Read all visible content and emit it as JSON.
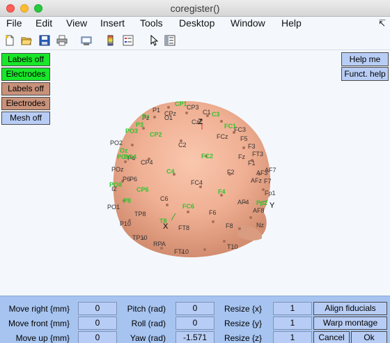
{
  "window": {
    "title": "coregister()"
  },
  "menu": [
    "File",
    "Edit",
    "View",
    "Insert",
    "Tools",
    "Desktop",
    "Window",
    "Help"
  ],
  "toolbar": [
    "new-figure-icon",
    "open-file-icon",
    "save-icon",
    "print-icon",
    "print-preview-icon",
    "colorbar-icon",
    "legend-icon",
    "pointer-icon",
    "property-editor-icon"
  ],
  "left_buttons": [
    {
      "label": "Labels off",
      "color": "#19e62a"
    },
    {
      "label": "Electrodes",
      "color": "#19e62a"
    },
    {
      "label": "Labels off",
      "color": "#c8917a"
    },
    {
      "label": "Electrodes",
      "color": "#c8917a"
    },
    {
      "label": "Mesh off",
      "color": "#b8cdf5"
    }
  ],
  "right_buttons": {
    "help": "Help me",
    "funct_help": "Funct. help"
  },
  "axes": {
    "x_marker": "X",
    "y_marker": "Y",
    "z_marker": "Z"
  },
  "electrodes_green": [
    "CP1",
    "C3",
    "FC1",
    "Pz",
    "P3",
    "CP2",
    "PO3",
    "Oz",
    "POz",
    "PO4",
    "FC2",
    "C4",
    "CP6",
    "PO8",
    "P8",
    "F4",
    "FC6",
    "Fp2",
    "T8"
  ],
  "electrodes_black": [
    "P1",
    "CP3",
    "CPz",
    "C1",
    "CzZ",
    "FC3",
    "FCz",
    "F3",
    "FT3",
    "F5",
    "Fz",
    "F1",
    "AF3",
    "AF7",
    "F7",
    "AFz",
    "F2",
    "FC4",
    "CP4",
    "C2",
    "P4",
    "PO2",
    "P6",
    "POz",
    "I2",
    "P6",
    "Fp1",
    "AF4",
    "AF8",
    "F6",
    "F8",
    "C6",
    "TP8",
    "P10",
    "TP10",
    "RPA",
    "FT8",
    "FT10",
    "Nz",
    "O1",
    "Pz",
    "T10",
    "PO1"
  ],
  "controls": {
    "move_right": {
      "label": "Move right {mm}",
      "value": "0"
    },
    "move_front": {
      "label": "Move front {mm}",
      "value": "0"
    },
    "move_up": {
      "label": "Move up {mm}",
      "value": "0"
    },
    "pitch": {
      "label": "Pitch (rad)",
      "value": "0"
    },
    "roll": {
      "label": "Roll (rad)",
      "value": "0"
    },
    "yaw": {
      "label": "Yaw (rad)",
      "value": "-1.571"
    },
    "resize_x": {
      "label": "Resize {x}",
      "value": "1"
    },
    "resize_y": {
      "label": "Resize {y}",
      "value": "1"
    },
    "resize_z": {
      "label": "Resize {z}",
      "value": "1"
    },
    "align": "Align fiducials",
    "warp": "Warp montage",
    "cancel": "Cancel",
    "ok": "Ok"
  }
}
